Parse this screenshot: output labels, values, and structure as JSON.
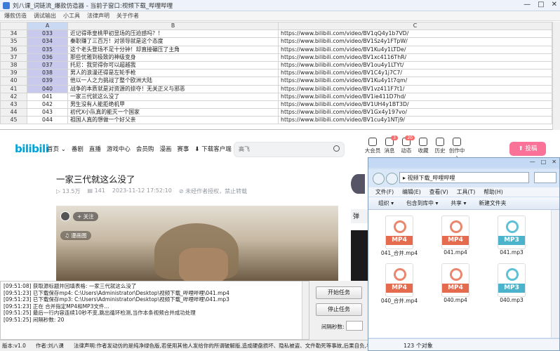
{
  "app": {
    "title": "刘八课_词链流_爆款仿造器 - 当前子窗口:视频下载_哔哩哔哩",
    "window_buttons": [
      "—",
      "□",
      "✕"
    ],
    "menu": [
      "爆款仿造",
      "调试输出",
      "小工具",
      "法律声明",
      "关于作者"
    ]
  },
  "grid": {
    "headers": [
      "",
      "A",
      "B",
      "C"
    ],
    "rows": [
      {
        "n": "34",
        "a": "033",
        "b": "近记得乖皇桃甲初显场的压迫感吗？！",
        "c": "https://www.bilibili.com/video/BV1qQ4y1b7VD/"
      },
      {
        "n": "35",
        "a": "034",
        "b": "秦职赚了三百万！对领导就是这个态度",
        "c": "https://www.bilibili.com/video/BV1Sz4y1FTpW/"
      },
      {
        "n": "36",
        "a": "035",
        "b": "这个老头登场不足十分钟！却直接碾压了主角",
        "c": "https://www.bilibili.com/video/BV1Ku4y1LTDe/"
      },
      {
        "n": "37",
        "a": "036",
        "b": "那些优雅到极致的神级变身",
        "c": "https://www.bilibili.com/video/BV1xc4116ThR/"
      },
      {
        "n": "38",
        "a": "037",
        "b": "托尼：我觉得你可以超越我",
        "c": "https://www.bilibili.com/video/BV1ou4y1LTYt/"
      },
      {
        "n": "39",
        "a": "038",
        "b": "男人的浪漫还得是左轮手枪",
        "c": "https://www.bilibili.com/video/BV1C4y1j7C7/"
      },
      {
        "n": "40",
        "a": "039",
        "b": "他以一人之力挑战了整个欧洲大陆",
        "c": "https://www.bilibili.com/video/BV1Ku4y1t7qm/"
      },
      {
        "n": "41",
        "a": "040",
        "b": "战争的本质就是对资源的掠夺！无关正义与邪恶",
        "c": "https://www.bilibili.com/video/BV1vz411F7t1/"
      },
      {
        "n": "42",
        "a": "041",
        "b": "一家三代就这么没了",
        "c": "https://www.bilibili.com/video/BV1ie411D7hd/"
      },
      {
        "n": "43",
        "a": "042",
        "b": "男生没有人能拒绝机甲",
        "c": "https://www.bilibili.com/video/BV1UH4y1BT3D/"
      },
      {
        "n": "44",
        "a": "043",
        "b": "初代X小队真的能灭一个国家",
        "c": "https://www.bilibili.com/video/BV1Gx4y197vo/"
      },
      {
        "n": "45",
        "a": "044",
        "b": "祖国人真的想做一个好父亲",
        "c": "https://www.bilibili.com/video/BV1cu4y1NTj9/"
      }
    ]
  },
  "bili": {
    "logo": "bilibili",
    "nav": [
      "首页 ⌄",
      "番剧",
      "直播",
      "游戏中心",
      "会员购",
      "漫画",
      "赛事",
      "⬇ 下载客户端"
    ],
    "search_placeholder": "高飞",
    "right_icons": [
      {
        "label": "大会员",
        "badge": ""
      },
      {
        "label": "消息",
        "badge": "3"
      },
      {
        "label": "动态",
        "badge": "20"
      },
      {
        "label": "收藏",
        "badge": ""
      },
      {
        "label": "历史",
        "badge": ""
      },
      {
        "label": "创作中心",
        "badge": ""
      }
    ],
    "upload": "⬆ 投稿",
    "video_title": "一家三代就这么没了",
    "meta_views": "▷ 13.5万",
    "meta_danmu": "▤ 141",
    "meta_date": "2023-11-12 17:52:10",
    "meta_warn": "⊘ 未经作者授权，禁止转载",
    "follow": "+ 关注",
    "up_tag": "♫ 漫画图",
    "danmu_side": "弹"
  },
  "log": [
    "[09:51:08] 获取源标题并回填表格:          一家三代就这么没了",
    "[09:51:23] 已下载保存mp4:      C:\\Users\\Administrator\\Desktop\\视频下载_哔哩哔哩\\041.mp4",
    "[09:51:23] 已下载保存mp3:      C:\\Users\\Administrator\\Desktop\\视频下载_哔哩哔哩\\041.mp3",
    "[09:51:23] 正在 合并指定MP4和MP3文件...",
    "[09:51:25] 最后一行内容连续10秒不变,跳出循环检测,当作本条视频合并成功处理",
    "[09:51:25] 间隔秒数: 20"
  ],
  "controls": {
    "start": "开始任务",
    "stop": "停止任务",
    "interval_label": "间隔秒数:"
  },
  "status": {
    "version": "版本:v1.0",
    "author": "作者:刘八课",
    "legal": "法律声明:作者发动仿的是纯净绿色版,若使用其他人发给你的所谓破解版,造成硬盘损坏、隐私被盗、文件勒死等事故,后果自负,与作者"
  },
  "explorer": {
    "window_buttons": [
      "—",
      "□",
      "✕"
    ],
    "address": "▸ 视频下载_哔哩哔哩",
    "menu": [
      "文件(F)",
      "编辑(E)",
      "查看(V)",
      "工具(T)",
      "帮助(H)"
    ],
    "commands": [
      "组织 ▾",
      "包含到库中 ▾",
      "共享 ▾",
      "新建文件夹"
    ],
    "files": [
      {
        "name": "041_合并.mp4",
        "type": "MP4"
      },
      {
        "name": "041.mp4",
        "type": "MP4"
      },
      {
        "name": "041.mp3",
        "type": "MP3"
      },
      {
        "name": "040_合并.mp4",
        "type": "MP4"
      },
      {
        "name": "040.mp4",
        "type": "MP4"
      },
      {
        "name": "040.mp3",
        "type": "MP3"
      }
    ],
    "status": "123 个对象"
  }
}
